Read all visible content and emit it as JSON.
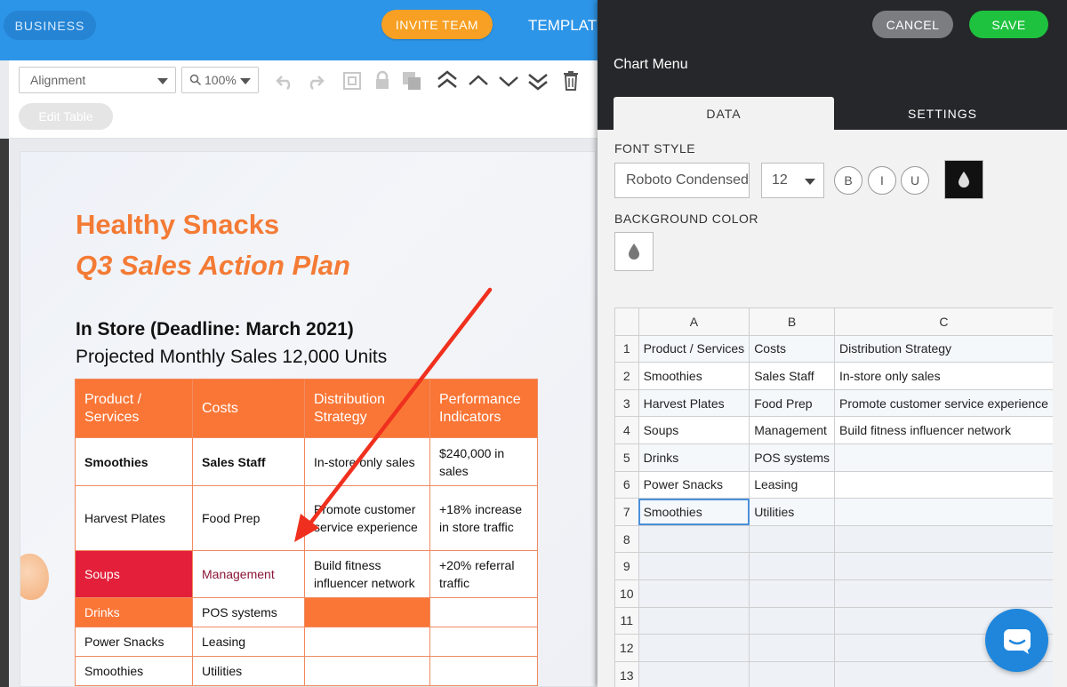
{
  "topbar": {
    "business_label": "BUSINESS",
    "invite_label": "INVITE TEAM",
    "templates_label": "TEMPLATE"
  },
  "toolbar": {
    "alignment_value": "Alignment",
    "zoom_value": "100%",
    "edit_table_label": "Edit Table",
    "icons": [
      "undo-icon",
      "redo-icon",
      "group-icon",
      "lock-icon",
      "duplicate-icon",
      "bring-to-front-icon",
      "move-up-icon",
      "move-down-icon",
      "send-to-back-icon",
      "delete-icon"
    ]
  },
  "document": {
    "title_line1": "Healthy Snacks",
    "title_line2": "Q3 Sales Action Plan",
    "subtitle_bold": "In Store (Deadline: March 2021)",
    "subtitle": "Projected Monthly Sales 12,000 Units",
    "table": {
      "headers": [
        "Product / Services",
        "Costs",
        "Distribution Strategy",
        "Performance Indicators"
      ],
      "rows": [
        [
          "Smoothies",
          "Sales Staff",
          "In-store only sales",
          "$240,000 in sales"
        ],
        [
          "Harvest Plates",
          "Food Prep",
          "Promote customer service experience",
          "+18% increase in store traffic"
        ],
        [
          "Soups",
          "Management",
          "Build fitness influencer network",
          "+20% referral traffic"
        ],
        [
          "Drinks",
          "POS systems",
          "",
          ""
        ],
        [
          "Power Snacks",
          "Leasing",
          "",
          ""
        ],
        [
          "Smoothies",
          "Utilities",
          "",
          ""
        ]
      ]
    },
    "colors": {
      "title_orange": "#f47b35",
      "header_orange": "#fa7636",
      "soups_red": "#e31f3a",
      "arrow_red": "#f0301e"
    }
  },
  "panel": {
    "cancel_label": "CANCEL",
    "save_label": "SAVE",
    "title": "Chart Menu",
    "tabs": [
      "DATA",
      "SETTINGS"
    ],
    "active_tab": "DATA",
    "font_style_label": "FONT STYLE",
    "font_family_value": "Roboto Condensed",
    "font_size_value": "12",
    "style_buttons": [
      "B",
      "I",
      "U"
    ],
    "font_color": "#111111",
    "background_color_label": "BACKGROUND COLOR",
    "grid": {
      "columns": [
        "A",
        "B",
        "C"
      ],
      "rows": [
        [
          "1",
          "Product / Services",
          "Costs",
          "Distribution Strategy"
        ],
        [
          "2",
          "Smoothies",
          "Sales Staff",
          "In-store only sales"
        ],
        [
          "3",
          "Harvest Plates",
          "Food Prep",
          "Promote customer service experience"
        ],
        [
          "4",
          "Soups",
          "Management",
          "Build fitness influencer network"
        ],
        [
          "5",
          "Drinks",
          "POS systems",
          ""
        ],
        [
          "6",
          "Power Snacks",
          "Leasing",
          ""
        ],
        [
          "7",
          "Smoothies",
          "Utilities",
          ""
        ],
        [
          "8",
          "",
          "",
          ""
        ],
        [
          "9",
          "",
          "",
          ""
        ],
        [
          "10",
          "",
          "",
          ""
        ],
        [
          "11",
          "",
          "",
          ""
        ],
        [
          "12",
          "",
          "",
          ""
        ],
        [
          "13",
          "",
          "",
          ""
        ]
      ],
      "selected_cell": "A7"
    }
  },
  "chat": {
    "icon": "chat-icon"
  }
}
